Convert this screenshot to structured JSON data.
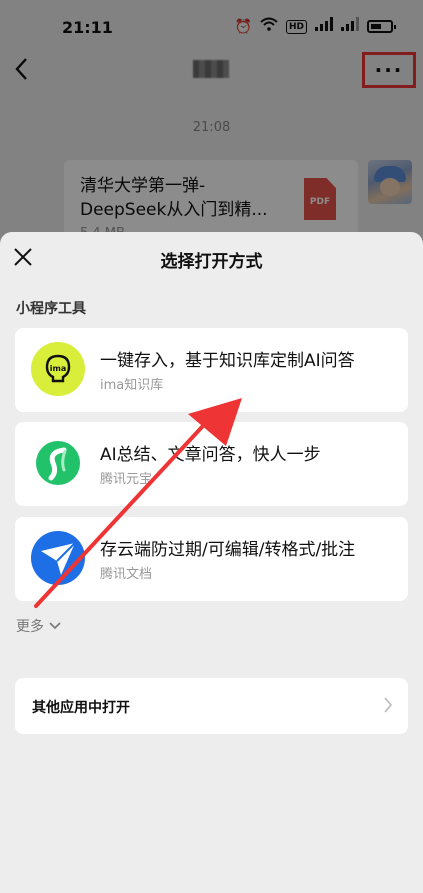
{
  "status_bar": {
    "time": "21:11",
    "hd_label": "HD"
  },
  "chat": {
    "message_time": "21:08",
    "file": {
      "name": "清华大学第一弹-DeepSeek从入门到精...",
      "size": "5.4 MB",
      "type_label": "PDF"
    }
  },
  "sheet": {
    "title": "选择打开方式",
    "section_label": "小程序工具",
    "tools": [
      {
        "title": "一键存入，基于知识库定制AI问答",
        "subtitle": "ima知识库",
        "icon": "ima-logo-icon",
        "logo_text": "ima"
      },
      {
        "title": "AI总结、文章问答，快人一步",
        "subtitle": "腾讯元宝",
        "icon": "yuanbao-logo-icon"
      },
      {
        "title": "存云端防过期/可编辑/转格式/批注",
        "subtitle": "腾讯文档",
        "icon": "tencent-docs-logo-icon"
      }
    ],
    "more_label": "更多",
    "other_app_label": "其他应用中打开"
  },
  "colors": {
    "annotation_red": "#ee3434",
    "ima_green": "#d8ee3a",
    "docs_blue": "#1e6fe6",
    "yuanbao_green": "#22c26a"
  }
}
